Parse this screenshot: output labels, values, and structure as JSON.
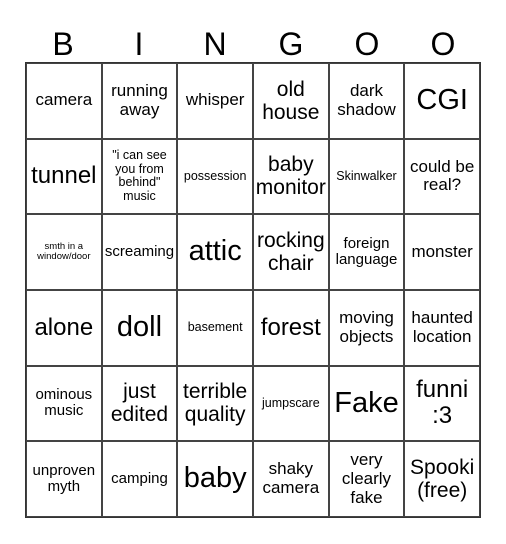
{
  "header": [
    "B",
    "I",
    "N",
    "G",
    "O",
    "O"
  ],
  "cells": [
    "camera",
    "running away",
    "whisper",
    "old house",
    "dark shadow",
    "CGI",
    "tunnel",
    "\"i can see you from behind\" music",
    "possession",
    "baby monitor",
    "Skinwalker",
    "could be real?",
    "smth in a window/door",
    "screaming",
    "attic",
    "rocking chair",
    "foreign language",
    "monster",
    "alone",
    "doll",
    "basement",
    "forest",
    "moving objects",
    "haunted location",
    "ominous music",
    "just edited",
    "terrible quality",
    "jumpscare",
    "Fake",
    "funni :3",
    "unproven myth",
    "camping",
    "baby",
    "shaky camera",
    "very clearly fake",
    "Spooki (free)"
  ]
}
